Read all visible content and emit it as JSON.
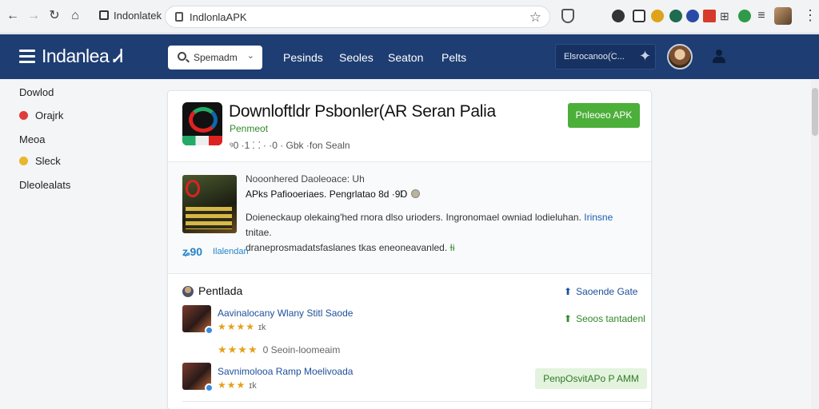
{
  "browser": {
    "tab_title": "Indonlatek",
    "url": "IndlonlaAPK",
    "extension_colors": [
      "#333333",
      "#e0a21a",
      "#1e6b50",
      "#2b4aa8",
      "#d63a2a",
      "#2f9a4a"
    ]
  },
  "header": {
    "logo": "Indanlea Ꮧ",
    "search_label": "Spemadm",
    "nav": [
      "Pesinds",
      "Seoles",
      "Seaton",
      "Pelts"
    ],
    "user_label": "Elsrocanoo(ۛC..."
  },
  "sidebar": {
    "items": [
      {
        "label": "Dowlod",
        "dot": ""
      },
      {
        "label": "Orajrk",
        "dot": "#e03b3b"
      },
      {
        "label": "Meoa",
        "dot": ""
      },
      {
        "label": "Sleck",
        "dot": "#e9b62c"
      },
      {
        "label": "Dleolealats",
        "dot": ""
      }
    ]
  },
  "app": {
    "title": "Downloftldr Psbonler(AR Seran Palia",
    "developer": "Penmeot",
    "meta": "ꝰ0 ·1 ⸬ · ·0 · Gbk ·fon Sealn",
    "download_label": "Pnleoeo APK"
  },
  "description": {
    "kicker": "Nooonhered Daoleoace: Uh",
    "subtitle": "APks Pafiooeriaes. Pengrlatao 8d ·9Ɒ",
    "body_main": "Doieneckaup olekaing'hed rnora dlso urioders. Ingronomael owniad lodieluhan.",
    "body_link": "Irinsne",
    "body_tail": "tnitae.",
    "body_line2": "draneprosmadatsfaslanes tkas eneoneavanled.",
    "body_line2_green": "Ɨɨ",
    "rating_value": "ʑ90",
    "rating_link": "Ilalendan"
  },
  "related": {
    "heading": "Pentlada",
    "top_action": "Saoende Gate",
    "second_action": "Seoos tantadenl",
    "items": [
      {
        "title": "Aavinalocany Wlany Stitl Saode",
        "stars": "★★★★",
        "count": "ɪk"
      },
      {
        "title": "Savnimolooa Ramp Moelivoada",
        "stars": "★★★",
        "count": "ɪk"
      }
    ],
    "middle_rating": {
      "stars": "★★★★",
      "text": "0 Seoin-loomeaim"
    },
    "item_button": "PenpOsvitAPo P AMM"
  }
}
